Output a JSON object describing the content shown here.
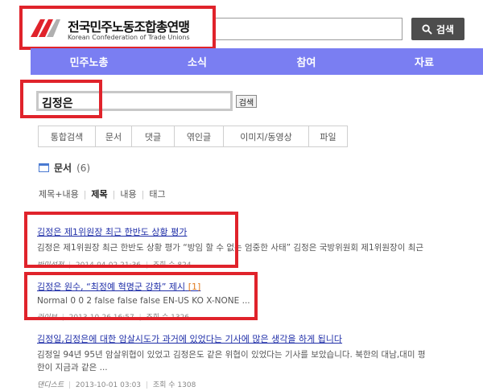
{
  "brand": {
    "title": "전국민주노동조합총연맹",
    "subtitle": "Korean Confederation of Trade Unions"
  },
  "top_search": {
    "button_label": "검색",
    "input_value": ""
  },
  "nav": [
    "민주노총",
    "소식",
    "참여",
    "자료"
  ],
  "query": {
    "value": "김정은",
    "button_label": "검색"
  },
  "tabs": [
    "통합검색",
    "문서",
    "댓글",
    "엮인글",
    "이미지/동영상",
    "파일"
  ],
  "section": {
    "title": "문서",
    "count": "(6)"
  },
  "filters": [
    "제목+내용",
    "제목",
    "내용",
    "태그"
  ],
  "results": [
    {
      "title": "김정은 제1위원장 최근 한반도 상황 평가",
      "comments": "",
      "snippet": "김정은 제1위원장 최근 한반도 상황 평가 “방임 할 수 없는 엄중한 사태” 김정은 국방위원회 제1위원장이 최근",
      "author": "반미성전",
      "date": "2014-04-02 21:36",
      "views_label": "조회 수",
      "views": "824"
    },
    {
      "title": "김정은 원수, “최정예 혁명군 강화” 제시",
      "comments": "[1]",
      "snippet": "Normal 0 0 2 false false false EN-US KO X-NONE ...",
      "author": "라이브",
      "date": "2013-10-26 16:57",
      "views_label": "조회 수",
      "views": "1326"
    },
    {
      "title": "김정일,김정은에 대한 암살시도가 과거에 있었다는 기사에 많은 생각을 하게 됩니다",
      "comments": "",
      "snippet": "김정일 94년 95년 암살위협이 있었고 김정은도 같은 위협이 있었다는 기사를 보았습니다. 북한의 대남,대미 평",
      "snippet2": "한이 지금과 같은 ...",
      "author": "댄디스트",
      "date": "2013-10-01 03:03",
      "views_label": "조회 수",
      "views": "1308"
    }
  ],
  "colors": {
    "nav_bg": "#7a7ef2",
    "highlight_box": "#e0232b",
    "link": "#1f2ea8"
  }
}
